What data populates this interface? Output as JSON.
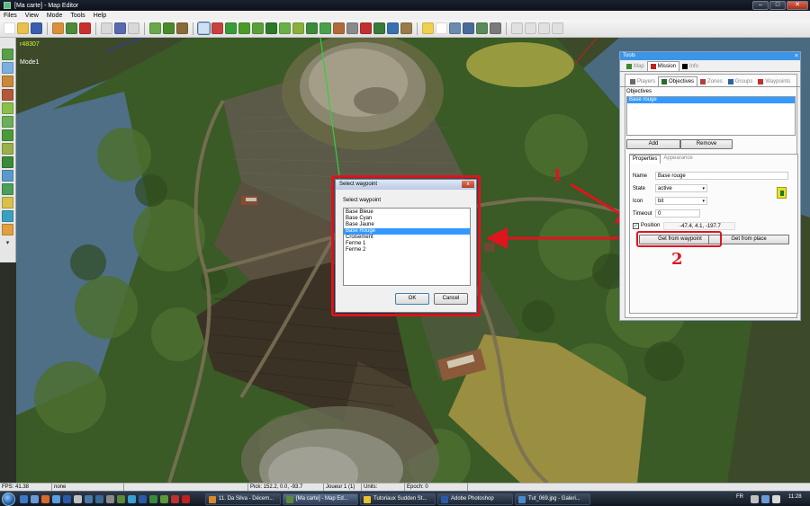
{
  "window": {
    "title": "[Ma carte] - Map Editor",
    "minimize": "–",
    "maximize": "□",
    "close": "✕"
  },
  "menu": [
    "Files",
    "View",
    "Mode",
    "Tools",
    "Help"
  ],
  "viewport": {
    "revision": "r48307",
    "mode": "Mode1"
  },
  "dialog": {
    "title": "Select waypoint",
    "close": "x",
    "label": "Select waypoint",
    "items": [
      "Base Bleue",
      "Base Cyan",
      "Base Jaune",
      "Base Rouge",
      "Croisement",
      "Ferme 1",
      "Ferme 2"
    ],
    "selected_index": 3,
    "ok": "OK",
    "cancel": "Cancel"
  },
  "tools": {
    "title": "Tools",
    "close": "×",
    "tabs": [
      {
        "label": "Map",
        "icon": "grid-icon",
        "color": "#3a8a2a"
      },
      {
        "label": "Mission",
        "icon": "mission-icon",
        "color": "#c02020"
      },
      {
        "label": "Info",
        "icon": "info-icon",
        "color": "#000000"
      }
    ],
    "active_tab": 1,
    "subtabs": [
      {
        "label": "Players",
        "icon": "players-icon",
        "color": "#6a6a6a"
      },
      {
        "label": "Objectives",
        "icon": "objectives-icon",
        "color": "#2a6a2a"
      },
      {
        "label": "Zones",
        "icon": "zones-icon",
        "color": "#b04040"
      },
      {
        "label": "Groups",
        "icon": "groups-icon",
        "color": "#3060a0"
      },
      {
        "label": "Waypoints",
        "icon": "waypoints-icon",
        "color": "#c03030"
      }
    ],
    "active_subtab": 1,
    "objectives_label": "Objectives",
    "objectives": [
      "Base rouge"
    ],
    "add": "Add",
    "remove": "Remove",
    "prop_tabs": [
      "Properties",
      "Appearance"
    ],
    "name_label": "Name",
    "name_value": "Base rouge",
    "state_label": "State",
    "state_value": "active",
    "icon_label": "Icon",
    "icon_value": "bit",
    "timeout_label": "Timeout",
    "timeout_value": "0",
    "position_label": "Position",
    "position_checked": "✓",
    "position_value": "-47.4, 4.1, -197.7",
    "get_waypoint": "Get from waypoint",
    "get_place": "Get from place",
    "caret": "▾"
  },
  "annotations": {
    "one": "1",
    "two": "2"
  },
  "statusbar": {
    "fps": "FPS: 41.38",
    "none": "none",
    "pick": "Pick: 152.2, 0.0, -93.7",
    "player": "Joueur 1 (1)",
    "units": "Units:",
    "epoch": "Epoch: 0"
  },
  "taskbar": {
    "tasks": [
      {
        "label": "11. Da Silva - Décem...",
        "color": "#d88a2a"
      },
      {
        "label": "[Ma carte] - Map Ed...",
        "color": "#5b8a3a"
      },
      {
        "label": "Tutoriaux Sudden St...",
        "color": "#e8c030"
      },
      {
        "label": "Adobe Photoshop",
        "color": "#2a5aa8"
      },
      {
        "label": "Tut_069.jpg - Galeri...",
        "color": "#4a8ac8"
      }
    ],
    "active_task": 1,
    "lang": "FR",
    "time": "11:28"
  },
  "colors": {
    "highlight": "#e0141e",
    "selection": "#3399ff",
    "accent": "#3d95e5"
  }
}
